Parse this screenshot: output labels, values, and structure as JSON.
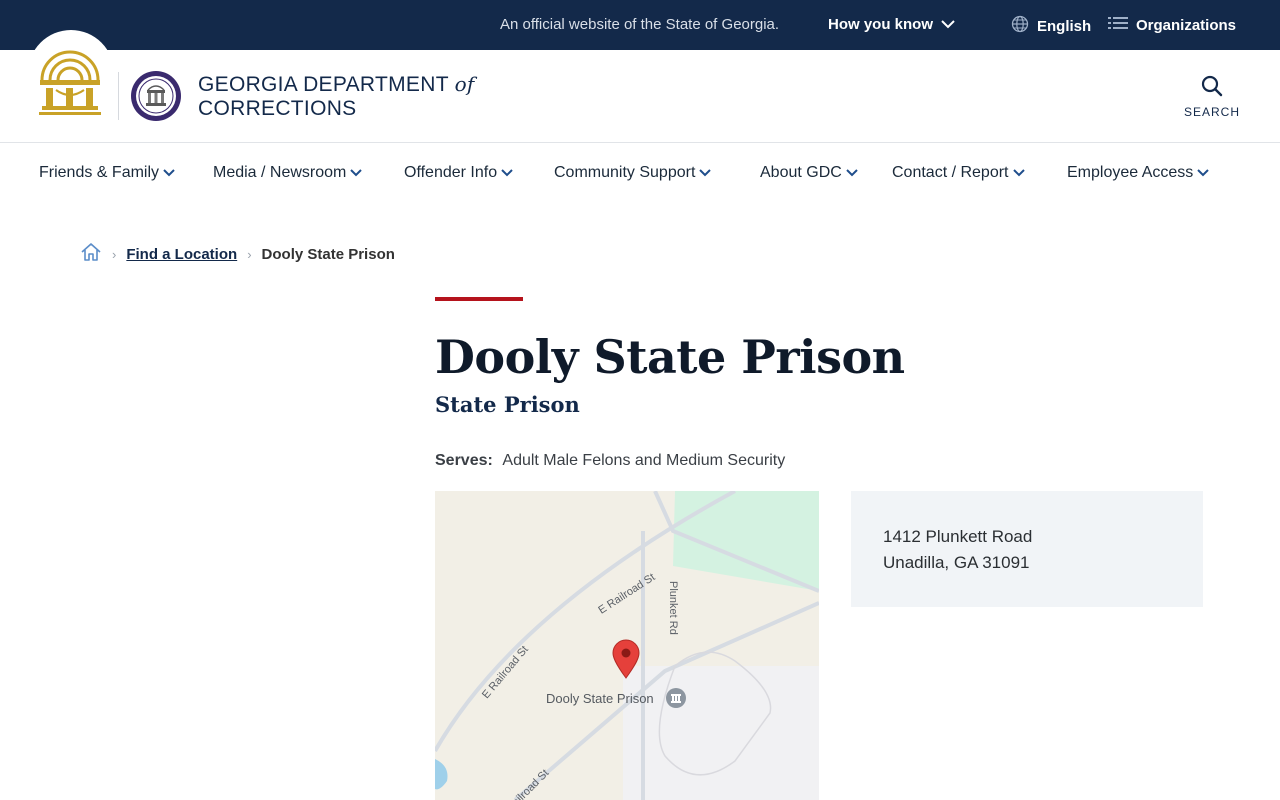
{
  "topbar": {
    "official_text": "An official website of the State of Georgia.",
    "how_you_know": "How you know",
    "language": "English",
    "organizations": "Organizations"
  },
  "header": {
    "brand_line1": "GEORGIA DEPARTMENT",
    "brand_of": "of",
    "brand_line2": "CORRECTIONS",
    "search_label": "SEARCH"
  },
  "nav": {
    "items": [
      {
        "label": "Friends & Family"
      },
      {
        "label": "Media / Newsroom"
      },
      {
        "label": "Offender Info"
      },
      {
        "label": "Community Support"
      },
      {
        "label": "About GDC"
      },
      {
        "label": "Contact / Report"
      },
      {
        "label": "Employee Access"
      }
    ]
  },
  "breadcrumb": {
    "link": "Find a Location",
    "current": "Dooly State Prison"
  },
  "page": {
    "title": "Dooly State Prison",
    "subtitle": "State Prison",
    "serves_label": "Serves:",
    "serves_value": "Adult Male Felons and Medium Security"
  },
  "map": {
    "street_e_railroad_1": "E Railroad St",
    "street_e_railroad_2": "E Railroad St",
    "street_plunket": "Plunket Rd",
    "street_railroad_3": "Railroad St",
    "place_label": "Dooly State Prison"
  },
  "address": {
    "line1": "1412 Plunkett Road",
    "line2": "Unadilla, GA 31091"
  },
  "colors": {
    "topbar_bg": "#13294a",
    "accent_red": "#b5131c",
    "brand_navy": "#13294a",
    "address_bg": "#f1f4f7"
  }
}
